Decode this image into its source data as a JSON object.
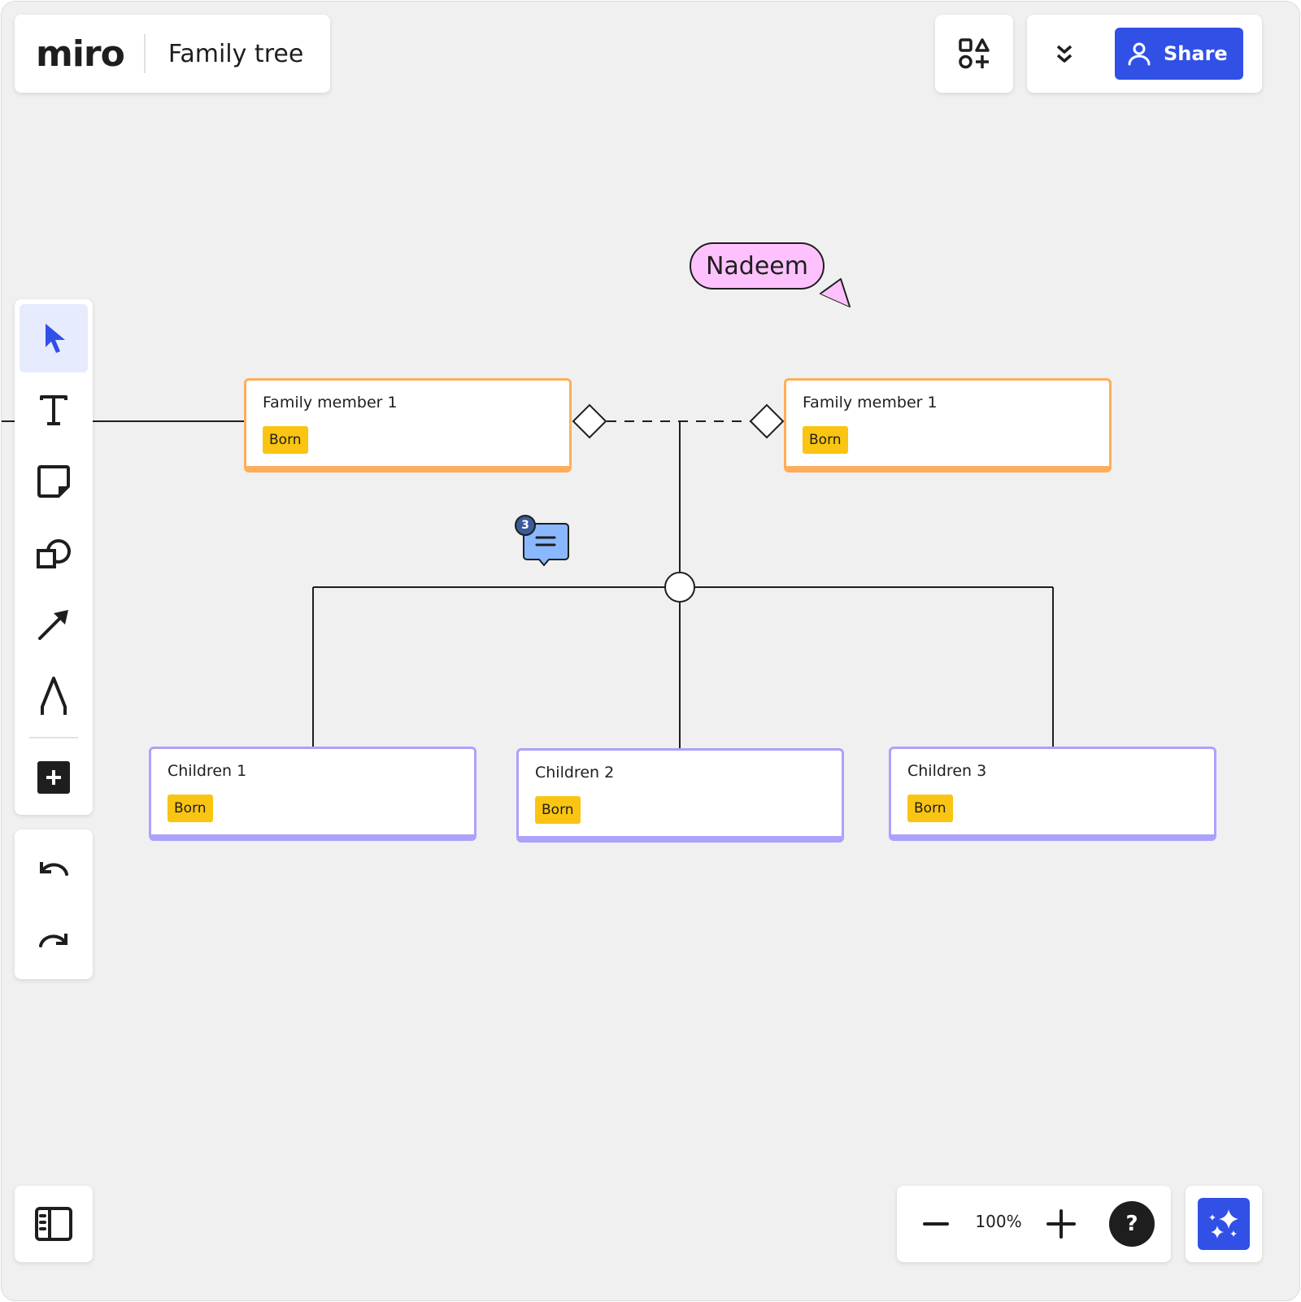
{
  "app": {
    "logo": "miro",
    "board_title": "Family tree"
  },
  "header": {
    "shapes_button_icon": "shapes-icon",
    "collapse_button_icon": "chevrons-down-icon",
    "share_label": "Share",
    "share_icon": "user-icon",
    "accent_color": "#3150e6"
  },
  "toolbar": {
    "tools": [
      {
        "name": "select",
        "icon": "cursor-arrow-icon",
        "active": true
      },
      {
        "name": "text",
        "icon": "text-icon",
        "active": false
      },
      {
        "name": "sticky-note",
        "icon": "sticky-note-icon",
        "active": false
      },
      {
        "name": "shapes",
        "icon": "shapes-icon",
        "active": false
      },
      {
        "name": "connection-line",
        "icon": "arrow-icon",
        "active": false
      },
      {
        "name": "pen",
        "icon": "pen-icon",
        "active": false
      },
      {
        "name": "more-apps",
        "icon": "plus-square-icon",
        "active": false
      }
    ],
    "undo_icon": "undo-icon",
    "redo_icon": "redo-icon"
  },
  "bottom": {
    "panel_toggle_icon": "sidebar-panel-icon",
    "zoom_out_icon": "minus-icon",
    "zoom_level": "100%",
    "zoom_in_icon": "plus-icon",
    "help_label": "?",
    "ai_icon": "sparkles-icon"
  },
  "canvas": {
    "cursor": {
      "user": "Nadeem",
      "color": "#fdc2fd"
    },
    "comment": {
      "count": "3"
    },
    "parents": [
      {
        "title": "Family member 1",
        "tag": "Born"
      },
      {
        "title": "Family member 1",
        "tag": "Born"
      }
    ],
    "children": [
      {
        "title": "Children 1",
        "tag": "Born"
      },
      {
        "title": "Children 2",
        "tag": "Born"
      },
      {
        "title": "Children 3",
        "tag": "Born"
      }
    ],
    "colors": {
      "parent_border": "#ffad5a",
      "child_border": "#aaa2fb",
      "tag": "#f9c512"
    }
  }
}
